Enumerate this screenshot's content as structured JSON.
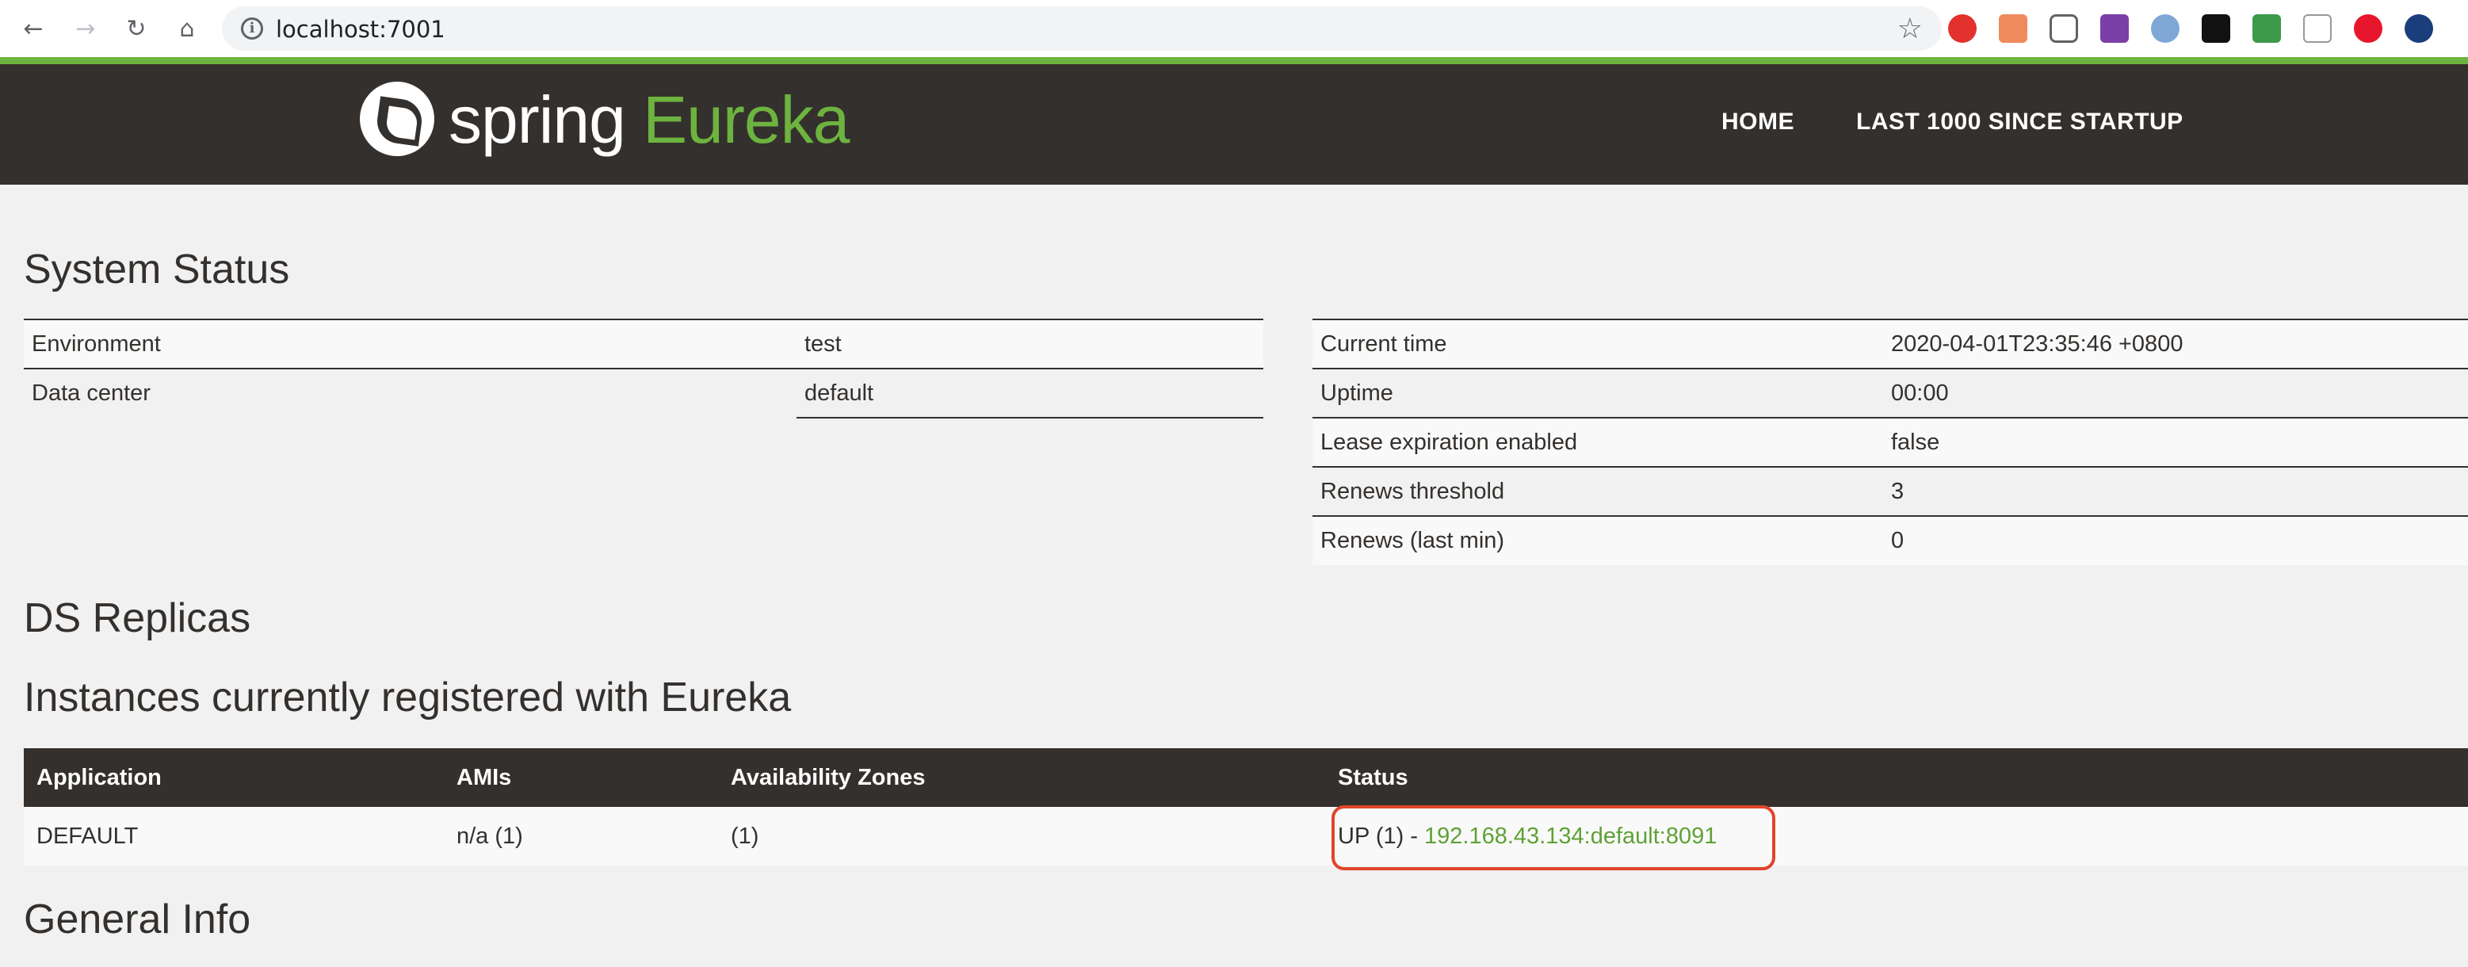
{
  "browser": {
    "url": "localhost:7001",
    "back_icon": "arrow-left-icon",
    "forward_icon": "arrow-right-icon",
    "reload_icon": "reload-icon",
    "home_icon": "home-icon",
    "info_icon": "info-icon",
    "bookmark_icon": "star-icon"
  },
  "header": {
    "logo_word1": "spring",
    "logo_word2": "Eureka",
    "nav": [
      "HOME",
      "LAST 1000 SINCE STARTUP"
    ]
  },
  "system_status": {
    "title": "System Status",
    "left": [
      {
        "label": "Environment",
        "value": "test"
      },
      {
        "label": "Data center",
        "value": "default"
      }
    ],
    "right": [
      {
        "label": "Current time",
        "value": "2020-04-01T23:35:46 +0800"
      },
      {
        "label": "Uptime",
        "value": "00:00"
      },
      {
        "label": "Lease expiration enabled",
        "value": "false"
      },
      {
        "label": "Renews threshold",
        "value": "3"
      },
      {
        "label": "Renews (last min)",
        "value": "0"
      }
    ]
  },
  "ds_replicas": {
    "title": "DS Replicas"
  },
  "instances": {
    "title": "Instances currently registered with Eureka",
    "columns": [
      "Application",
      "AMIs",
      "Availability Zones",
      "Status"
    ],
    "rows": [
      {
        "application": "DEFAULT",
        "amis": "n/a (1)",
        "zones": "(1)",
        "status_prefix": "UP (1) - ",
        "status_link": "192.168.43.134:default:8091"
      }
    ]
  },
  "general_info": {
    "title": "General Info"
  },
  "colors": {
    "brand_green": "#6db33f",
    "navbar": "#34302d",
    "highlight": "#e0452b"
  }
}
